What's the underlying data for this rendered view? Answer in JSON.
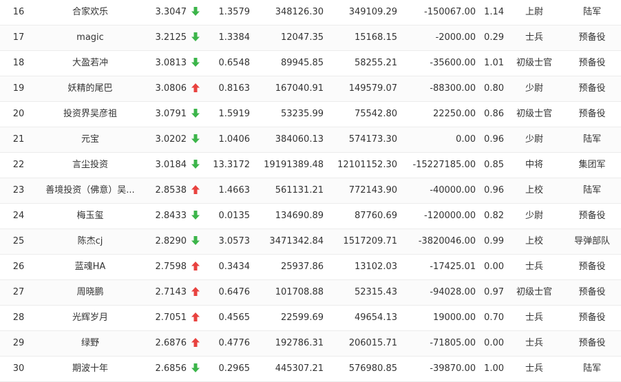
{
  "colors": {
    "up": "#e8423f",
    "down": "#3cb54a"
  },
  "rows": [
    {
      "rank": "16",
      "name": "合家欢乐",
      "score": "3.3047",
      "trend": "down",
      "v1": "1.3579",
      "v2": "348126.30",
      "v3": "349109.29",
      "v4": "-150067.00",
      "v5": "1.14",
      "title": "上尉",
      "army": "陆军"
    },
    {
      "rank": "17",
      "name": "magic",
      "score": "3.2125",
      "trend": "down",
      "v1": "1.3384",
      "v2": "12047.35",
      "v3": "15168.15",
      "v4": "-2000.00",
      "v5": "0.29",
      "title": "士兵",
      "army": "预备役"
    },
    {
      "rank": "18",
      "name": "大盈若冲",
      "score": "3.0813",
      "trend": "down",
      "v1": "0.6548",
      "v2": "89945.85",
      "v3": "58255.21",
      "v4": "-35600.00",
      "v5": "1.01",
      "title": "初级士官",
      "army": "预备役"
    },
    {
      "rank": "19",
      "name": "妖精的尾巴",
      "score": "3.0806",
      "trend": "up",
      "v1": "0.8163",
      "v2": "167040.91",
      "v3": "149579.07",
      "v4": "-88300.00",
      "v5": "0.80",
      "title": "少尉",
      "army": "预备役"
    },
    {
      "rank": "20",
      "name": "投资界吴彦祖",
      "score": "3.0791",
      "trend": "down",
      "v1": "1.5919",
      "v2": "53235.99",
      "v3": "75542.80",
      "v4": "22250.00",
      "v5": "0.86",
      "title": "初级士官",
      "army": "预备役"
    },
    {
      "rank": "21",
      "name": "元宝",
      "score": "3.0202",
      "trend": "down",
      "v1": "1.0406",
      "v2": "384060.13",
      "v3": "574173.30",
      "v4": "0.00",
      "v5": "0.96",
      "title": "少尉",
      "army": "陆军"
    },
    {
      "rank": "22",
      "name": "言尘投资",
      "score": "3.0184",
      "trend": "down",
      "v1": "13.3172",
      "v2": "19191389.48",
      "v3": "12101152.30",
      "v4": "-15227185.00",
      "v5": "0.85",
      "title": "中将",
      "army": "集团军"
    },
    {
      "rank": "23",
      "name": "善境投资（佛意）吴...",
      "score": "2.8538",
      "trend": "up",
      "v1": "1.4663",
      "v2": "561131.21",
      "v3": "772143.90",
      "v4": "-40000.00",
      "v5": "0.96",
      "title": "上校",
      "army": "陆军"
    },
    {
      "rank": "24",
      "name": "梅玉玺",
      "score": "2.8433",
      "trend": "down",
      "v1": "0.0135",
      "v2": "134690.89",
      "v3": "87760.69",
      "v4": "-120000.00",
      "v5": "0.82",
      "title": "少尉",
      "army": "预备役"
    },
    {
      "rank": "25",
      "name": "陈杰cj",
      "score": "2.8290",
      "trend": "down",
      "v1": "3.0573",
      "v2": "3471342.84",
      "v3": "1517209.71",
      "v4": "-3820046.00",
      "v5": "0.99",
      "title": "上校",
      "army": "导弹部队"
    },
    {
      "rank": "26",
      "name": "蓝魂HA",
      "score": "2.7598",
      "trend": "up",
      "v1": "0.3434",
      "v2": "25937.86",
      "v3": "13102.03",
      "v4": "-17425.01",
      "v5": "0.00",
      "title": "士兵",
      "army": "预备役"
    },
    {
      "rank": "27",
      "name": "周晓鹏",
      "score": "2.7143",
      "trend": "up",
      "v1": "0.6476",
      "v2": "101708.88",
      "v3": "52315.43",
      "v4": "-94028.00",
      "v5": "0.97",
      "title": "初级士官",
      "army": "预备役"
    },
    {
      "rank": "28",
      "name": "光辉岁月",
      "score": "2.7051",
      "trend": "up",
      "v1": "0.4565",
      "v2": "22599.69",
      "v3": "49654.13",
      "v4": "19000.00",
      "v5": "0.70",
      "title": "士兵",
      "army": "预备役"
    },
    {
      "rank": "29",
      "name": "绿野",
      "score": "2.6876",
      "trend": "up",
      "v1": "0.4776",
      "v2": "192786.31",
      "v3": "206015.71",
      "v4": "-71805.00",
      "v5": "0.00",
      "title": "士兵",
      "army": "预备役"
    },
    {
      "rank": "30",
      "name": "期波十年",
      "score": "2.6856",
      "trend": "down",
      "v1": "0.2965",
      "v2": "445307.21",
      "v3": "576980.85",
      "v4": "-39870.00",
      "v5": "1.00",
      "title": "士兵",
      "army": "陆军"
    }
  ]
}
